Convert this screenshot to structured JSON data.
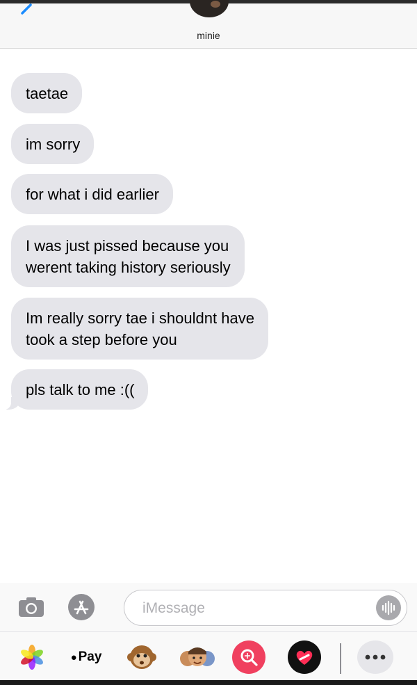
{
  "contact": {
    "name": "minie"
  },
  "messages": [
    {
      "text": "taetae",
      "tail": false
    },
    {
      "text": "im sorry",
      "tail": false
    },
    {
      "text": "for what i did earlier",
      "tail": false
    },
    {
      "text": "I was just pissed because you\nwerent taking history seriously",
      "tail": false
    },
    {
      "text": "Im really sorry tae i shouldnt have\ntook a step before you",
      "tail": false
    },
    {
      "text": "pls talk to me :((",
      "tail": true
    }
  ],
  "composer": {
    "placeholder": "iMessage"
  },
  "app_drawer": {
    "items": [
      {
        "name": "photos-app-icon"
      },
      {
        "name": "apple-pay-button",
        "label": "Pay"
      },
      {
        "name": "animoji-monkey-icon"
      },
      {
        "name": "memoji-icon"
      },
      {
        "name": "image-search-icon"
      },
      {
        "name": "digital-touch-icon"
      },
      {
        "name": "more-apps-icon"
      }
    ]
  },
  "colors": {
    "bubble": "#e5e5ea",
    "accent": "#1a8cff",
    "search_app": "#f0405f"
  }
}
